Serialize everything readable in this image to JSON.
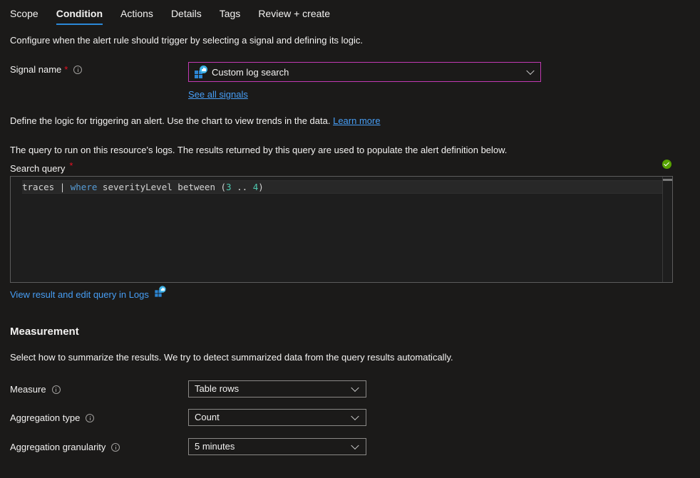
{
  "tabs": [
    {
      "label": "Scope",
      "active": false
    },
    {
      "label": "Condition",
      "active": true
    },
    {
      "label": "Actions",
      "active": false
    },
    {
      "label": "Details",
      "active": false
    },
    {
      "label": "Tags",
      "active": false
    },
    {
      "label": "Review + create",
      "active": false
    }
  ],
  "intro": "Configure when the alert rule should trigger by selecting a signal and defining its logic.",
  "signal": {
    "label": "Signal name",
    "required_mark": "*",
    "value": "Custom log search",
    "icon": "log-analytics-icon",
    "see_all_link": "See all signals"
  },
  "logic": {
    "text": "Define the logic for triggering an alert. Use the chart to view trends in the data.",
    "learn_more": "Learn more"
  },
  "query": {
    "description": "The query to run on this resource's logs. The results returned by this query are used to populate the alert definition below.",
    "label": "Search query",
    "required_mark": "*",
    "tokens": {
      "table": "traces",
      "pipe": "|",
      "keyword": "where",
      "field": "severityLevel",
      "op": "between",
      "open": "(",
      "low": "3",
      "range": "..",
      "high": "4",
      "close": ")"
    },
    "status": "valid",
    "status_icon": "check-circle-icon",
    "view_link": "View result and edit query in Logs",
    "accent_color": "#569cd6",
    "number_color": "#4ec9b0"
  },
  "measurement": {
    "heading": "Measurement",
    "description": "Select how to summarize the results. We try to detect summarized data from the query results automatically.",
    "fields": [
      {
        "label": "Measure",
        "value": "Table rows"
      },
      {
        "label": "Aggregation type",
        "value": "Count"
      },
      {
        "label": "Aggregation granularity",
        "value": "5 minutes"
      }
    ]
  },
  "colors": {
    "background": "#1b1a19",
    "tab_underline": "#2b88d8",
    "link": "#479ef5",
    "signal_border": "#c239b3",
    "required": "#e81123",
    "check": "#57a300"
  }
}
